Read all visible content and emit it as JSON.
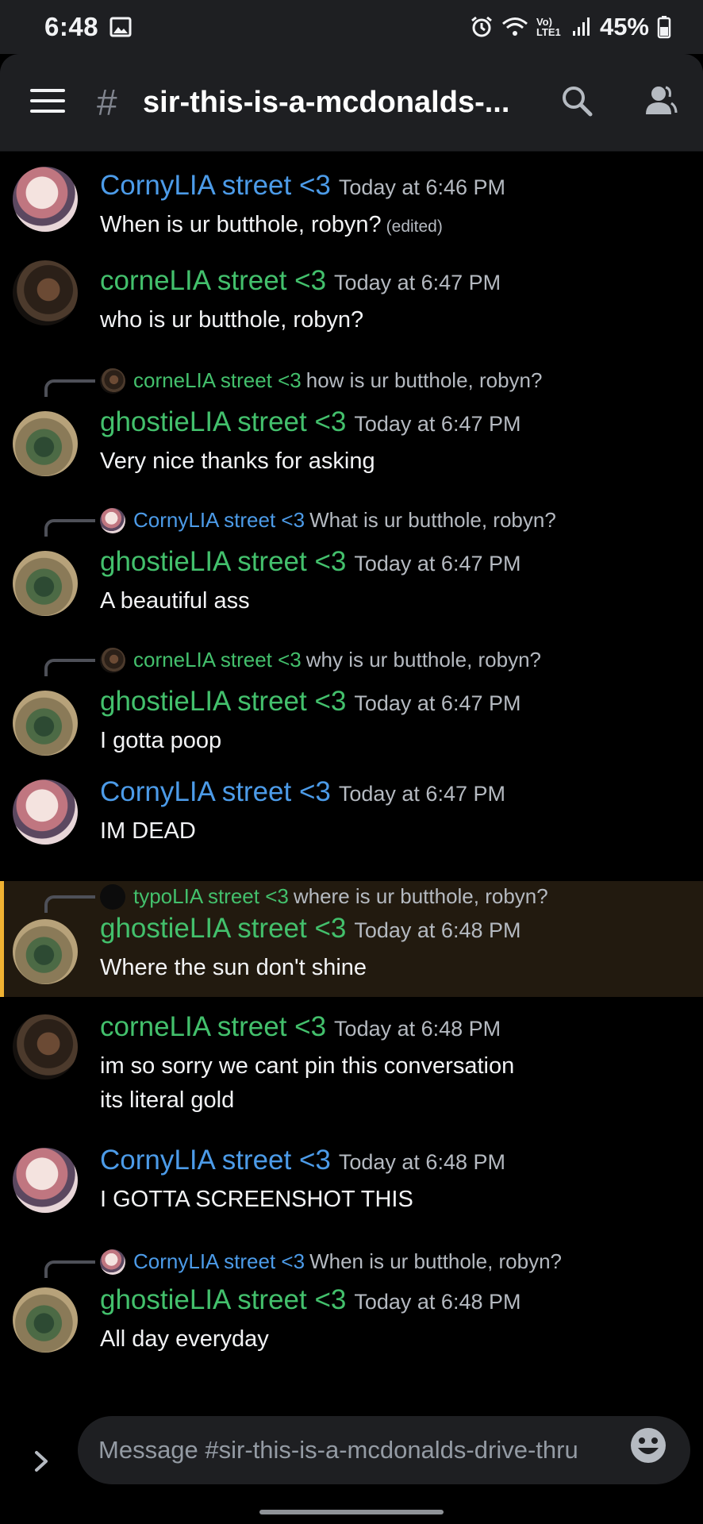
{
  "status_bar": {
    "time": "6:48",
    "battery": "45%",
    "network": "Vo) LTE1"
  },
  "header": {
    "hash": "#",
    "channel_name": "sir-this-is-a-mcdonalds-..."
  },
  "colors": {
    "blue_user": "#4c9be8",
    "green_user": "#43c06c",
    "highlight_bar": "#f0b232"
  },
  "messages": [
    {
      "author": "CornyLIA street <3",
      "timestamp": "Today at 6:46 PM",
      "text": "When is ur butthole, robyn?",
      "edited": "(edited)"
    },
    {
      "author": "corneLIA street <3",
      "timestamp": "Today at 6:47 PM",
      "text": "who is ur butthole, robyn?"
    },
    {
      "reply_author": "corneLIA street <3",
      "reply_text": "how is ur butthole, robyn?",
      "author": "ghostieLIA street <3",
      "timestamp": "Today at 6:47 PM",
      "text": "Very nice thanks for asking"
    },
    {
      "reply_author": "CornyLIA street <3",
      "reply_text": "What is ur butthole, robyn?",
      "author": "ghostieLIA street <3",
      "timestamp": "Today at 6:47 PM",
      "text": "A beautiful ass"
    },
    {
      "reply_author": "corneLIA street <3",
      "reply_text": "why is ur butthole, robyn?",
      "author": "ghostieLIA street <3",
      "timestamp": "Today at 6:47 PM",
      "text": "I gotta poop"
    },
    {
      "author": "CornyLIA street <3",
      "timestamp": "Today at 6:47 PM",
      "text": "IM DEAD"
    },
    {
      "reply_author": "typoLIA street <3",
      "reply_text": "where is ur butthole, robyn?",
      "author": "ghostieLIA street <3",
      "timestamp": "Today at 6:48 PM",
      "text": "Where the sun don't shine"
    },
    {
      "author": "corneLIA street <3",
      "timestamp": "Today at 6:48 PM",
      "text_line1": "im so sorry we cant pin this conversation",
      "text_line2": "its literal gold"
    },
    {
      "author": "CornyLIA street <3",
      "timestamp": "Today at 6:48 PM",
      "text": "I GOTTA SCREENSHOT THIS"
    },
    {
      "reply_author": "CornyLIA street <3",
      "reply_text": "When is ur butthole, robyn?",
      "author": "ghostieLIA street <3",
      "timestamp": "Today at 6:48 PM",
      "text": "All day everyday"
    }
  ],
  "composer": {
    "placeholder": "Message #sir-this-is-a-mcdonalds-drive-thru"
  }
}
